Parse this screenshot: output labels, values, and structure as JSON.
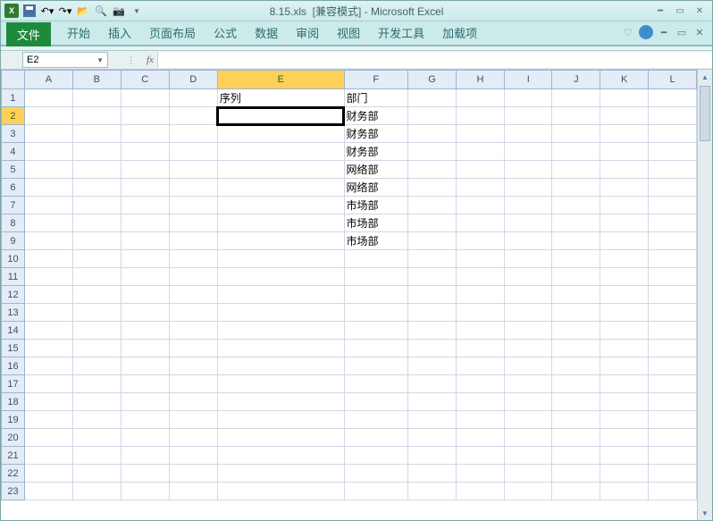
{
  "title": {
    "filename": "8.15.xls",
    "mode": "[兼容模式]",
    "app": "Microsoft Excel"
  },
  "tabs": {
    "file": "文件",
    "start": "开始",
    "insert": "插入",
    "layout": "页面布局",
    "formula": "公式",
    "data": "数据",
    "review": "审阅",
    "view": "视图",
    "dev": "开发工具",
    "addin": "加载项"
  },
  "namebox": "E2",
  "fx": "fx",
  "columns": [
    "A",
    "B",
    "C",
    "D",
    "E",
    "F",
    "G",
    "H",
    "I",
    "J",
    "K",
    "L"
  ],
  "selected_col": "E",
  "selected_row": 2,
  "rows": 23,
  "cells": {
    "E1": "序列",
    "F1": "部门",
    "F2": "财务部",
    "F3": "财务部",
    "F4": "财务部",
    "F5": "网络部",
    "F6": "网络部",
    "F7": "市场部",
    "F8": "市场部",
    "F9": "市场部"
  },
  "col_widths": {
    "default": 54,
    "E": 150,
    "F": 70
  }
}
